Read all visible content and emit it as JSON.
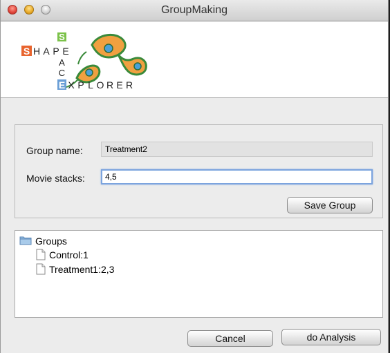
{
  "window": {
    "title": "GroupMaking"
  },
  "logo": {
    "row1": [
      "S",
      "H",
      "A",
      "P",
      "E"
    ],
    "vertical": [
      "S",
      "A",
      "C",
      "E"
    ],
    "row3": [
      "E",
      "X",
      "P",
      "L",
      "O",
      "R",
      "E",
      "R"
    ]
  },
  "form": {
    "group_name_label": "Group name:",
    "group_name_value": "Treatment2",
    "movie_stacks_label": "Movie stacks:",
    "movie_stacks_value": "4,5",
    "save_label": "Save Group"
  },
  "tree": {
    "root": "Groups",
    "items": [
      "Control:1",
      "Treatment1:2,3"
    ]
  },
  "footer": {
    "cancel_label": "Cancel",
    "analysis_label": "do Analysis"
  }
}
